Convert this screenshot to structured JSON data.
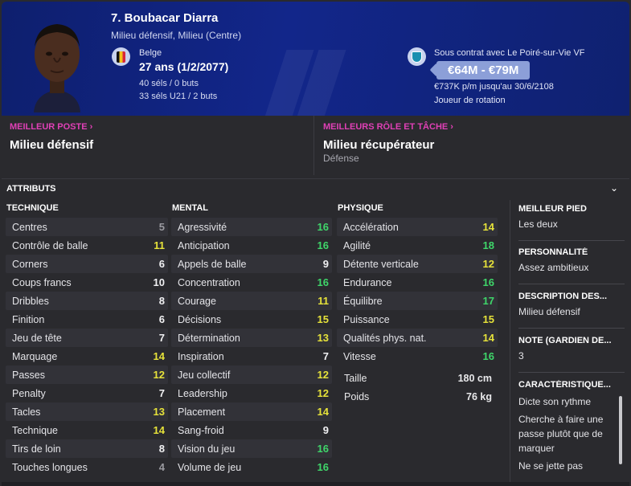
{
  "header": {
    "name": "7. Boubacar Diarra",
    "role": "Milieu défensif, Milieu (Centre)",
    "nationality": "Belge",
    "age": "27 ans (1/2/2077)",
    "caps": "40 séls / 0 buts",
    "u21caps": "33 séls U21 / 2 buts",
    "contract": "Sous contrat avec Le Poiré-sur-Vie VF",
    "value": "€64M - €79M",
    "wage": "€737K p/m jusqu'au 30/6/2108",
    "status": "Joueur de rotation"
  },
  "best_position": {
    "label": "MEILLEUR POSTE",
    "value": "Milieu défensif"
  },
  "best_role": {
    "label": "MEILLEURS RÔLE ET TÂCHE",
    "value": "Milieu récupérateur",
    "duty": "Défense"
  },
  "attributes_title": "ATTRIBUTS",
  "columns": {
    "technique": "TECHNIQUE",
    "mental": "MENTAL",
    "physique": "PHYSIQUE"
  },
  "technique": [
    {
      "name": "Centres",
      "value": "5",
      "tier": "g"
    },
    {
      "name": "Contrôle de balle",
      "value": "11",
      "tier": "y"
    },
    {
      "name": "Corners",
      "value": "6",
      "tier": "w"
    },
    {
      "name": "Coups francs",
      "value": "10",
      "tier": "w"
    },
    {
      "name": "Dribbles",
      "value": "8",
      "tier": "w"
    },
    {
      "name": "Finition",
      "value": "6",
      "tier": "w"
    },
    {
      "name": "Jeu de tête",
      "value": "7",
      "tier": "w"
    },
    {
      "name": "Marquage",
      "value": "14",
      "tier": "y"
    },
    {
      "name": "Passes",
      "value": "12",
      "tier": "y"
    },
    {
      "name": "Penalty",
      "value": "7",
      "tier": "w"
    },
    {
      "name": "Tacles",
      "value": "13",
      "tier": "y"
    },
    {
      "name": "Technique",
      "value": "14",
      "tier": "y"
    },
    {
      "name": "Tirs de loin",
      "value": "8",
      "tier": "w"
    },
    {
      "name": "Touches longues",
      "value": "4",
      "tier": "g"
    }
  ],
  "mental": [
    {
      "name": "Agressivité",
      "value": "16",
      "tier": "gr"
    },
    {
      "name": "Anticipation",
      "value": "16",
      "tier": "gr"
    },
    {
      "name": "Appels de balle",
      "value": "9",
      "tier": "w"
    },
    {
      "name": "Concentration",
      "value": "16",
      "tier": "gr"
    },
    {
      "name": "Courage",
      "value": "11",
      "tier": "y"
    },
    {
      "name": "Décisions",
      "value": "15",
      "tier": "y"
    },
    {
      "name": "Détermination",
      "value": "13",
      "tier": "y"
    },
    {
      "name": "Inspiration",
      "value": "7",
      "tier": "w"
    },
    {
      "name": "Jeu collectif",
      "value": "12",
      "tier": "y"
    },
    {
      "name": "Leadership",
      "value": "12",
      "tier": "y"
    },
    {
      "name": "Placement",
      "value": "14",
      "tier": "y"
    },
    {
      "name": "Sang-froid",
      "value": "9",
      "tier": "w"
    },
    {
      "name": "Vision du jeu",
      "value": "16",
      "tier": "gr"
    },
    {
      "name": "Volume de jeu",
      "value": "16",
      "tier": "gr"
    }
  ],
  "physique": [
    {
      "name": "Accélération",
      "value": "14",
      "tier": "y"
    },
    {
      "name": "Agilité",
      "value": "18",
      "tier": "gr"
    },
    {
      "name": "Détente verticale",
      "value": "12",
      "tier": "y"
    },
    {
      "name": "Endurance",
      "value": "16",
      "tier": "gr"
    },
    {
      "name": "Équilibre",
      "value": "17",
      "tier": "gr"
    },
    {
      "name": "Puissance",
      "value": "15",
      "tier": "y"
    },
    {
      "name": "Qualités phys. nat.",
      "value": "14",
      "tier": "y"
    },
    {
      "name": "Vitesse",
      "value": "16",
      "tier": "gr"
    }
  ],
  "body": {
    "height_label": "Taille",
    "height": "180 cm",
    "weight_label": "Poids",
    "weight": "76 kg"
  },
  "side": {
    "foot_label": "MEILLEUR PIED",
    "foot": "Les deux",
    "personality_label": "PERSONNALITÉ",
    "personality": "Assez ambitieux",
    "description_label": "DESCRIPTION DES...",
    "description": "Milieu défensif",
    "gk_label": "NOTE (GARDIEN DE...",
    "gk": "3",
    "traits_label": "CARACTÉRISTIQUE...",
    "traits": [
      "Dicte son rythme",
      "Cherche à faire une passe plutôt que de marquer",
      "Ne se jette pas"
    ]
  },
  "colors": {
    "header": "#12268a",
    "accent": "#e040b6",
    "green": "#3fd66a",
    "yellow": "#e6e23a"
  }
}
